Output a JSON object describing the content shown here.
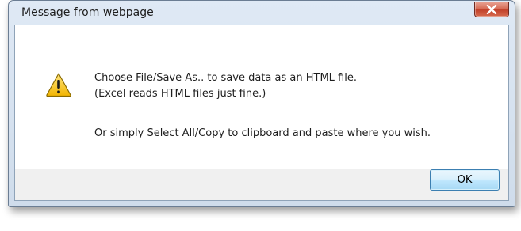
{
  "dialog": {
    "title": "Message from webpage",
    "close_icon": "close-icon",
    "warning_icon": "warning-icon",
    "message": {
      "line1": "Choose File/Save As.. to save data as an HTML file.",
      "line2": "(Excel reads HTML files just fine.)",
      "line3": "Or simply Select All/Copy to clipboard and paste where you wish."
    },
    "ok_label": "OK"
  },
  "colors": {
    "close_button": "#c2412a",
    "ok_button_border": "#3c7fb1",
    "warning_fill": "#f7c700"
  }
}
